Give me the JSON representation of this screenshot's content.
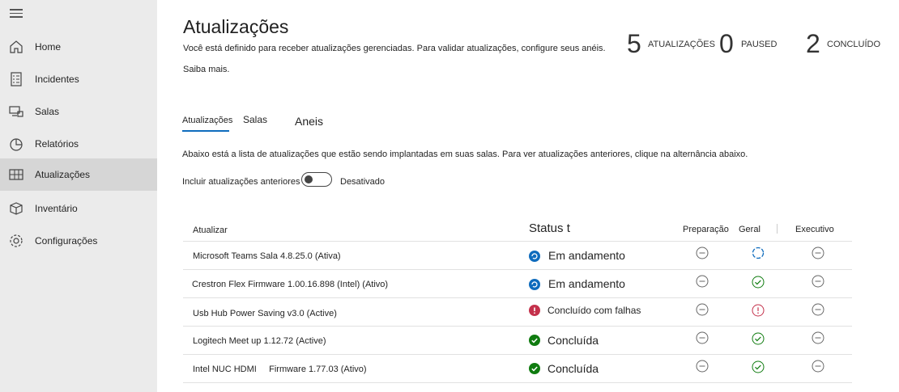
{
  "sidebar": {
    "items": [
      {
        "label": "Home",
        "icon": "home-icon"
      },
      {
        "label": "Incidentes",
        "icon": "incidents-icon"
      },
      {
        "label": "Salas",
        "icon": "rooms-icon"
      },
      {
        "label": "Relatórios",
        "icon": "reports-icon"
      },
      {
        "label": "Atualizações",
        "icon": "updates-icon",
        "active": true
      },
      {
        "label": "Inventário",
        "icon": "inventory-icon"
      },
      {
        "label": "Configurações",
        "icon": "settings-icon"
      }
    ]
  },
  "header": {
    "title": "Atualizações",
    "subtitle": "Você está definido para receber atualizações gerenciadas. Para validar atualizações, configure seus anéis.",
    "learn_more": "Saiba mais."
  },
  "stats": [
    {
      "value": "5",
      "label": "ATUALIZAÇÕES"
    },
    {
      "value": "0",
      "label": "PAUSED"
    },
    {
      "value": "2",
      "label": "CONCLUÍDO"
    }
  ],
  "tabs": [
    {
      "label": "Atualizações",
      "selected": true
    },
    {
      "label": "Salas"
    },
    {
      "label": "Aneis"
    }
  ],
  "description": "Abaixo está a lista de atualizações que estão sendo implantadas em suas salas. Para ver atualizações anteriores, clique na alternância abaixo.",
  "toggle": {
    "label": "Incluir atualizações anteriores",
    "state": "Desativado",
    "on": false
  },
  "table": {
    "headers": {
      "update": "Atualizar",
      "status": "Status t",
      "prep": "Preparação",
      "general": "Geral",
      "exec": "Executivo"
    },
    "rows": [
      {
        "name": "Microsoft Teams Sala 4.8.25.0 (Ativa)",
        "status": "Em andamento",
        "status_kind": "progress",
        "prep": "none",
        "general": "progress",
        "exec": "none"
      },
      {
        "name": "Crestron Flex Firmware 1.00.16.898 (Intel) (Ativo)",
        "status": "Em andamento",
        "status_kind": "progress",
        "prep": "none",
        "general": "done",
        "exec": "none"
      },
      {
        "name": "Usb Hub Power Saving v3.0 (Active)",
        "status": "Concluído com falhas",
        "status_kind": "error",
        "prep": "none",
        "general": "error",
        "exec": "none"
      },
      {
        "name": "Logitech Meet up 1.12.72 (Active)",
        "status": "Concluída",
        "status_kind": "done",
        "prep": "none",
        "general": "done",
        "exec": "none"
      },
      {
        "name": "Intel NUC HDMI     Firmware 1.77.03 (Ativo)",
        "status": "Concluída",
        "status_kind": "done",
        "prep": "none",
        "general": "done",
        "exec": "none"
      }
    ]
  },
  "colors": {
    "accent": "#0f6cbd",
    "success": "#107c10",
    "error": "#c4314b",
    "sidebar_bg": "#ebebeb",
    "selected_bg": "#d6d6d6"
  }
}
